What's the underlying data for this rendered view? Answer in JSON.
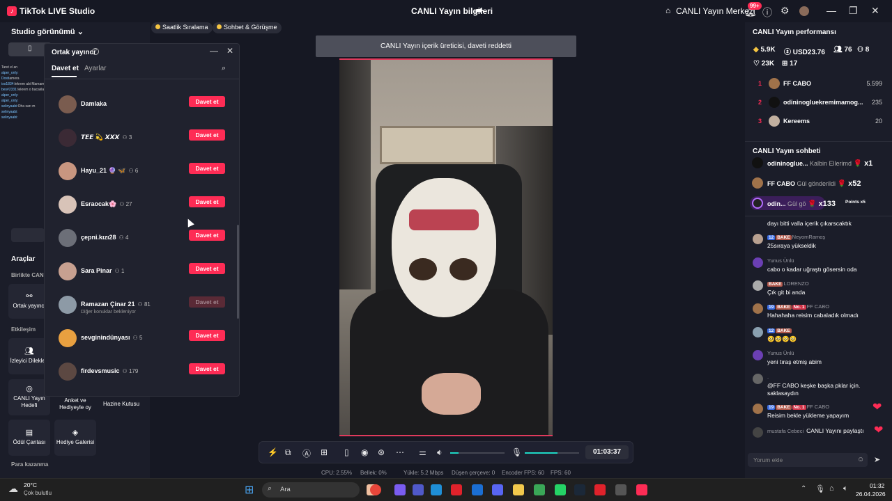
{
  "titlebar": {
    "app_title": "TikTok LIVE Studio",
    "center_title": "CANLI Yayın bilgileri",
    "live_center": "CANLI Yayın Merkezi",
    "notif_badge": "99+"
  },
  "left": {
    "view_title": "Studio görünümü",
    "mini_chat": [
      {
        "name": "",
        "text": "Tanıt el an"
      },
      {
        "name": "alper_only:",
        "text": ""
      },
      {
        "name": "Dosti",
        "text": "amera"
      },
      {
        "name": "iso1834:",
        "text": "lekrem abi Mamam da giydiğin şort bu dom"
      },
      {
        "name": "bes#2331:",
        "text": "lekrem o bacaklar için kurşun kurşun yerim abi"
      },
      {
        "name": "alper_only:",
        "text": ""
      },
      {
        "name": "alper_only:",
        "text": ""
      },
      {
        "name": "selinyaabi:",
        "text": "Oha sarı m"
      },
      {
        "name": "selinyaabi:",
        "text": ""
      },
      {
        "name": "selinyaabi:",
        "text": ""
      }
    ],
    "tools_title": "Araçlar",
    "section_together": "Birlikte CAN",
    "section_interaction": "Etkileşim",
    "section_money": "Para kazanma",
    "tools": {
      "cohost": "Ortak yayıncı",
      "viewer_requests": "İzleyici Dilekleri",
      "live_goal": "CANLI Yayın Hedefi",
      "poll_gift": "Anket ve Hediyeyle oy",
      "treasure": "Hazine Kutusu",
      "reward_bag": "Ödül Çantası",
      "gift_gallery": "Hediye Galerisi"
    }
  },
  "chips": [
    "Saatlik Sıralama",
    "Sohbet & Görüşme"
  ],
  "modal": {
    "title": "Ortak yayıncı",
    "tab_invite": "Davet et",
    "tab_settings": "Ayarlar",
    "rows": [
      {
        "name": "Damlaka",
        "count": "",
        "sub": "",
        "button": "Davet et",
        "disabled": false
      },
      {
        "name": "𝙏𝙀𝙀 💫 𝙓𝙓𝙓",
        "count": "3",
        "sub": "",
        "button": "Davet et",
        "disabled": false
      },
      {
        "name": "Hayu_21 🔮 🦋",
        "count": "6",
        "sub": "",
        "button": "Davet et",
        "disabled": false
      },
      {
        "name": "Esraocak🌸",
        "count": "27",
        "sub": "",
        "button": "Davet et",
        "disabled": false
      },
      {
        "name": "çepni.kızı28",
        "count": "4",
        "sub": "",
        "button": "Davet et",
        "disabled": false
      },
      {
        "name": "Sara Pinar",
        "count": "1",
        "sub": "",
        "button": "Davet et",
        "disabled": false
      },
      {
        "name": "Ramazan Çinar 21",
        "count": "81",
        "sub": "Diğer konuklar bekleniyor",
        "button": "Davet et",
        "disabled": true
      },
      {
        "name": "sevginindünyası",
        "count": "5",
        "sub": "",
        "button": "Davet et",
        "disabled": false
      },
      {
        "name": "firdevsmusic",
        "count": "179",
        "sub": "",
        "button": "Davet et",
        "disabled": false
      }
    ]
  },
  "toast": "CANLI Yayın içerik üreticisi, daveti reddetti",
  "controls": {
    "timer": "01:03:37",
    "volume_level": 0.15,
    "mic_level": 0.6
  },
  "stats": {
    "cpu": "CPU: 2.55%",
    "memory": "Bellek: 0%",
    "upload": "Yükle: 5.2 Mbps",
    "dropped": "Düşen çerçeve: 0",
    "encoder_fps": "Encoder FPS: 60",
    "fps": "FPS: 60"
  },
  "performance": {
    "title": "CANLI Yayın performansı",
    "coins": "5.9K",
    "usd": "USD23.76",
    "viewers": "76",
    "users": "8",
    "likes": "23K",
    "gifts": "17",
    "ranking": [
      {
        "rank": "1",
        "name": "FF CABO",
        "score": "5.599"
      },
      {
        "rank": "2",
        "name": "odininogluekremimamog...",
        "score": "235"
      },
      {
        "rank": "3",
        "name": "Kereems",
        "score": "20"
      }
    ]
  },
  "chat": {
    "title": "CANLI Yayın sohbeti",
    "gifts": [
      {
        "name": "odininoglue...",
        "text": "Kalbin Ellerimd",
        "mult": "x1"
      },
      {
        "name": "FF CABO",
        "text": "Gül gönderildi",
        "mult": "x52"
      },
      {
        "name": "odin...",
        "text": "Gül gö",
        "mult": "x133",
        "extra": "Points x5"
      }
    ],
    "messages": [
      {
        "user": "",
        "tags": [],
        "text": "dayı bitti valla içerik çıkarscaktık"
      },
      {
        "user": "NeyomRamoş",
        "tags": [
          "12",
          "BAKE"
        ],
        "text": "25sıraya yükseldik"
      },
      {
        "user": "Yunus Ünlü",
        "tags": [],
        "text": "cabo o kadar uğraştı gösersin oda"
      },
      {
        "user": "LORENZO",
        "tags": [
          "BAKE"
        ],
        "text": "Çık git bi anda"
      },
      {
        "user": "FF CABO",
        "tags": [
          "19",
          "BAKE",
          "No. 1"
        ],
        "text": "Hahahaha reisim cabaladık olmadı"
      },
      {
        "user": "",
        "tags": [
          "12",
          "BAKE"
        ],
        "text": "🥺🥺🥺🥺"
      },
      {
        "user": "Yunus Ünlü",
        "tags": [],
        "text": "yeni tıraş etmiş abim"
      },
      {
        "user": ".",
        "tags": [],
        "text": "@FF CABO keşke başka pklar için. saklasaydın"
      },
      {
        "user": "FF CABO",
        "tags": [
          "19",
          "BAKE",
          "No. 1"
        ],
        "text": "Reisim bekle yükleme yapayım"
      },
      {
        "user": "mustafa Cebeci",
        "tags": [],
        "text": "CANLI Yayını paylaştı"
      }
    ],
    "placeholder": "Yorum ekle"
  },
  "taskbar": {
    "temp": "20°C",
    "weather": "Çok bulutlu",
    "search": "Ara",
    "time": "01:32",
    "date": "26.04.2026"
  }
}
